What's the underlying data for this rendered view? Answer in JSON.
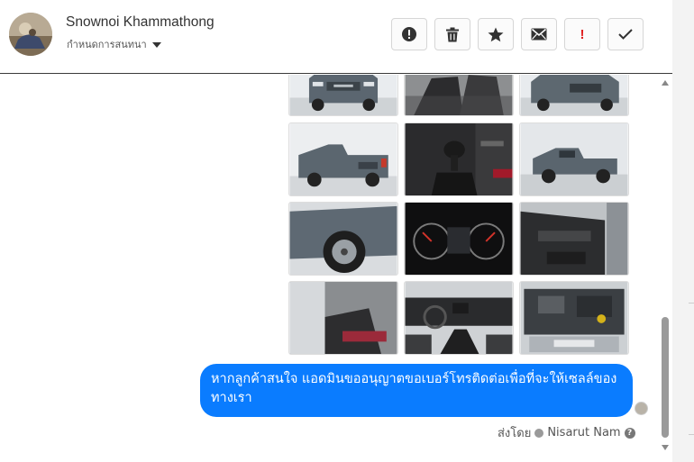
{
  "contact": {
    "name": "Snownoi Khammathong",
    "conversation_label": "กำหนดการสนทนา"
  },
  "actions": [
    {
      "name": "alert-icon",
      "label": ""
    },
    {
      "name": "trash-icon",
      "label": ""
    },
    {
      "name": "star-icon",
      "label": ""
    },
    {
      "name": "mail-icon",
      "label": ""
    },
    {
      "name": "urgent-icon",
      "label": "!"
    },
    {
      "name": "check-icon",
      "label": ""
    }
  ],
  "photos": [
    {
      "name": "photo-truck-front"
    },
    {
      "name": "photo-seats-interior"
    },
    {
      "name": "photo-truck-front-angle"
    },
    {
      "name": "photo-truck-rear"
    },
    {
      "name": "photo-gear-shift"
    },
    {
      "name": "photo-truck-side"
    },
    {
      "name": "photo-wheel-closeup"
    },
    {
      "name": "photo-instrument-cluster"
    },
    {
      "name": "photo-door-panel"
    },
    {
      "name": "photo-rear-seats"
    },
    {
      "name": "photo-dashboard"
    },
    {
      "name": "photo-engine-bay"
    }
  ],
  "message": {
    "text": "หากลูกค้าสนใจ แอดมินขออนุญาตขอเบอร์โทรติดต่อเพื่อที่จะให้เซลล์ของทางเรา"
  },
  "footer": {
    "sent_by_label": "ส่งโดย",
    "sender_name": "Nisarut Nam",
    "help": "?"
  },
  "colors": {
    "bubble": "#0a7cff",
    "urgent": "#e02020"
  }
}
